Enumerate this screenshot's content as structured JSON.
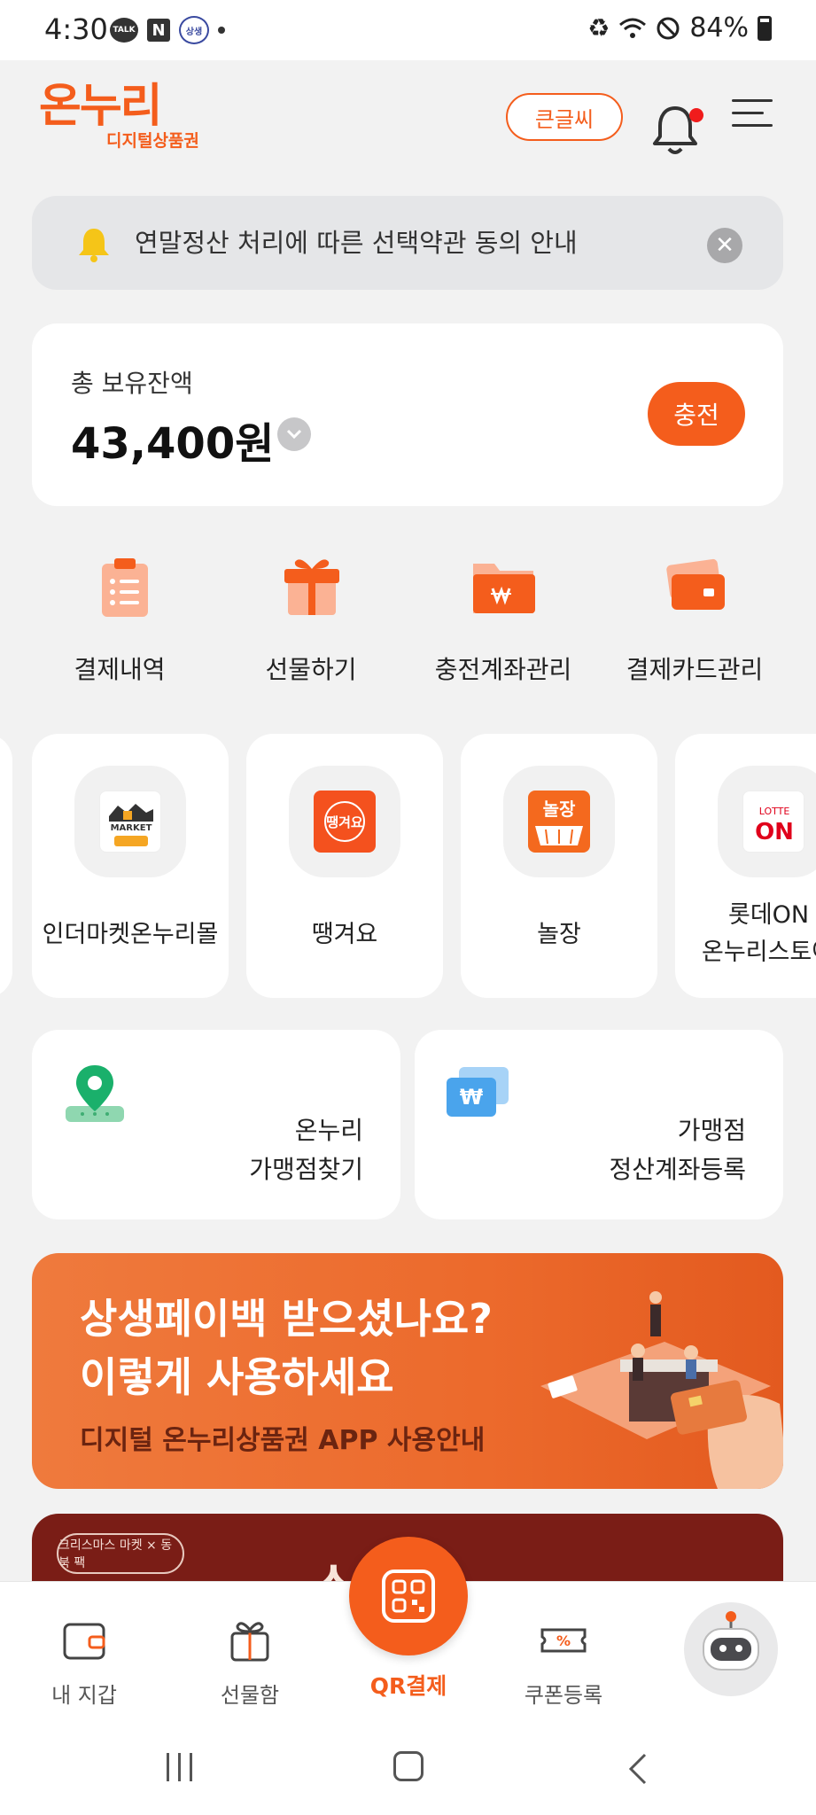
{
  "status_bar": {
    "time": "4:30",
    "notif_talk": "TALK",
    "notif_n": "N",
    "notif_ss": "상생\n페이백",
    "battery": "84%"
  },
  "header": {
    "logo_main": "온누리",
    "logo_sub": "디지털상품권",
    "big_text_button": "큰글씨",
    "brand_color": "#f45d1c"
  },
  "notice": {
    "text": "연말정산 처리에 따른 선택약관 동의 안내",
    "close": "✕"
  },
  "balance": {
    "label": "총 보유잔액",
    "amount": "43,400원",
    "charge_button": "충전"
  },
  "quick_menu": [
    {
      "label": "결제내역",
      "icon": "receipt-icon"
    },
    {
      "label": "선물하기",
      "icon": "gift-icon"
    },
    {
      "label": "충전계좌관리",
      "icon": "folder-won-icon"
    },
    {
      "label": "결제카드관리",
      "icon": "card-icon"
    }
  ],
  "partners": [
    {
      "label": "인더마켓온누리몰",
      "logo_text": "in the MARKET",
      "logo_sub": "온누리몰"
    },
    {
      "label": "땡겨요",
      "logo_text": "땡겨요"
    },
    {
      "label": "놀장",
      "logo_text": "놀장"
    },
    {
      "label_line1": "롯데ON",
      "label_line2": "온누리스토어",
      "logo_top": "LOTTE",
      "logo_main": "ON"
    }
  ],
  "finders": [
    {
      "line1": "온누리",
      "line2": "가맹점찾기"
    },
    {
      "line1": "가맹점",
      "line2": "정산계좌등록",
      "icon_text": "₩"
    }
  ],
  "banner": {
    "line1": "상생페이백 받으셨나요?",
    "line2": "이렇게 사용하세요",
    "line3": "디지털 온누리상품권 APP 사용안내"
  },
  "banner2": {
    "badge": "크리스마스 마켓 × 동북 팩",
    "title": "스       의"
  },
  "bottom_nav": {
    "wallet": "내 지갑",
    "giftbox": "선물함",
    "qr": "QR결제",
    "coupon": "쿠폰등록"
  }
}
